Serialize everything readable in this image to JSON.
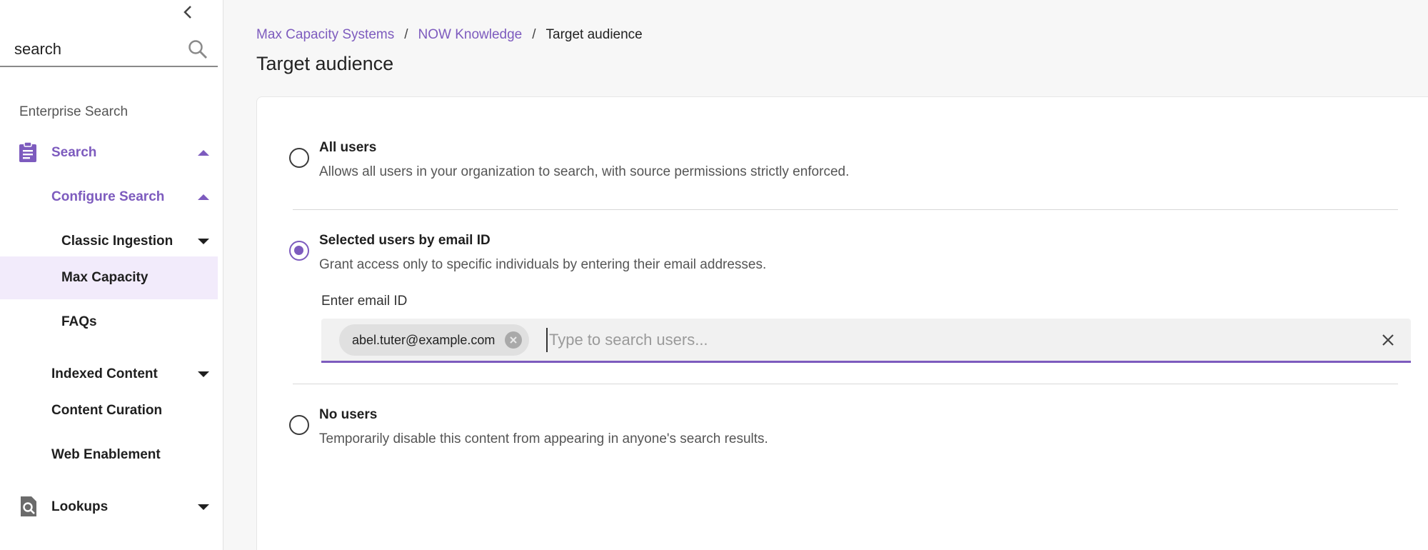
{
  "sidebar": {
    "search_value": "search",
    "section_title": "Enterprise Search",
    "items": {
      "search": "Search",
      "configure_search": "Configure Search",
      "classic_ingestion": "Classic Ingestion",
      "max_capacity": "Max Capacity",
      "faqs": "FAQs",
      "indexed_content": "Indexed Content",
      "content_curation": "Content Curation",
      "web_enablement": "Web Enablement",
      "lookups": "Lookups"
    }
  },
  "breadcrumb": {
    "items": [
      "Max Capacity Systems",
      "NOW Knowledge",
      "Target audience"
    ],
    "separator": "/"
  },
  "page_title": "Target audience",
  "options": [
    {
      "title": "All users",
      "description": "Allows all users in your organization to search, with source permissions strictly enforced.",
      "selected": false
    },
    {
      "title": "Selected users by email ID",
      "description": "Grant access only to specific individuals by entering their email addresses.",
      "selected": true
    },
    {
      "title": "No users",
      "description": "Temporarily disable this content from appearing in anyone's search results.",
      "selected": false
    }
  ],
  "email": {
    "label": "Enter email ID",
    "chips": [
      "abel.tuter@example.com"
    ],
    "placeholder": "Type to search users..."
  },
  "colors": {
    "accent": "#7d5bbe",
    "active_bg": "#f2ebfb"
  }
}
